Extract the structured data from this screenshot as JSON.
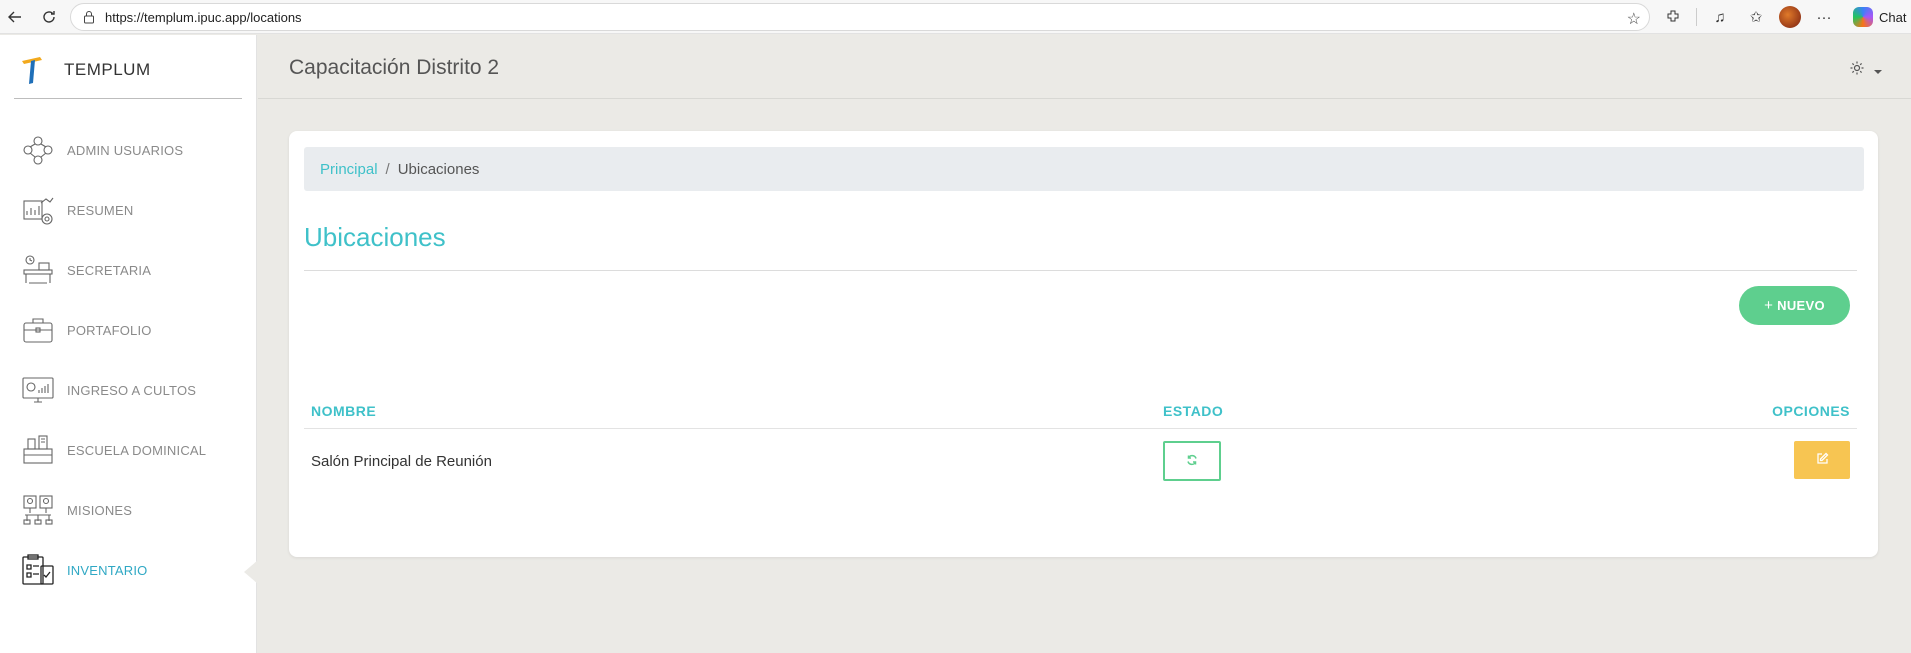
{
  "browser": {
    "url": "https://templum.ipuc.app/locations",
    "chat_label": "Chat"
  },
  "brand": {
    "name": "TEMPLUM",
    "colors": {
      "blue": "#1f6fb8",
      "orange": "#f2a91d"
    }
  },
  "sidebar": {
    "items": [
      {
        "label": "ADMIN USUARIOS",
        "icon": "users-network-icon",
        "active": false
      },
      {
        "label": "RESUMEN",
        "icon": "report-chart-icon",
        "active": false
      },
      {
        "label": "SECRETARIA",
        "icon": "desk-clock-icon",
        "active": false
      },
      {
        "label": "PORTAFOLIO",
        "icon": "briefcase-icon",
        "active": false
      },
      {
        "label": "INGRESO A CULTOS",
        "icon": "monitor-stats-icon",
        "active": false
      },
      {
        "label": "ESCUELA DOMINICAL",
        "icon": "classroom-desk-icon",
        "active": false
      },
      {
        "label": "MISIONES",
        "icon": "people-hierarchy-icon",
        "active": false
      },
      {
        "label": "INVENTARIO",
        "icon": "inventory-clipboard-icon",
        "active": true
      }
    ]
  },
  "header": {
    "title": "Capacitación Distrito 2",
    "settings_icon": "gear-icon"
  },
  "breadcrumb": {
    "home": "Principal",
    "separator": "/",
    "current": "Ubicaciones"
  },
  "page": {
    "title": "Ubicaciones",
    "new_button": {
      "icon": "+",
      "label": "NUEVO"
    }
  },
  "table": {
    "columns": [
      "NOMBRE",
      "ESTADO",
      "OPCIONES"
    ],
    "rows": [
      {
        "nombre": "Salón Principal de Reunión",
        "estado_icon": "refresh-icon",
        "opciones_icon": "edit-icon"
      }
    ]
  },
  "colors": {
    "accent": "#3fc1c9",
    "success": "#5ecf8e",
    "warning": "#f7c552",
    "active_nav": "#2fa8c4"
  }
}
